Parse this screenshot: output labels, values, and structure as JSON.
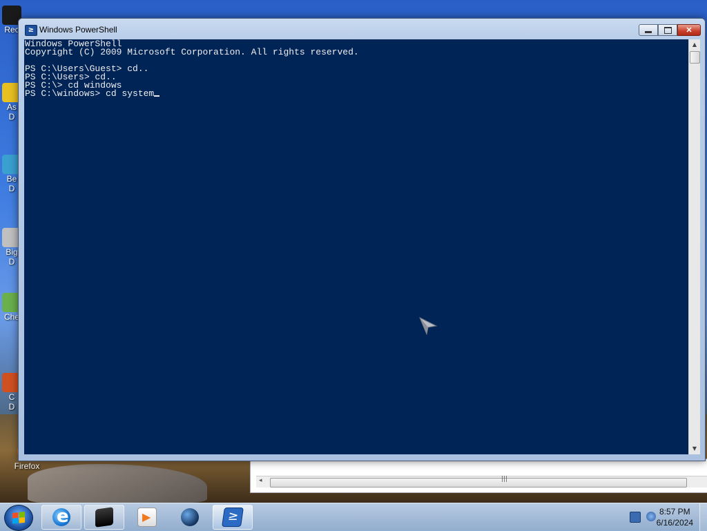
{
  "desktop": {
    "icons": [
      {
        "label": "Rec",
        "color": "#1a1a1a"
      },
      {
        "label": "As\nD",
        "color": "#e8c020"
      },
      {
        "label": "Be\nD",
        "color": "#3aa0d0"
      },
      {
        "label": "Big\nD",
        "color": "#c0c0c0"
      },
      {
        "label": "Che",
        "color": "#6ab04c"
      },
      {
        "label": "C\nD",
        "color": "#d05020"
      },
      {
        "label": "Firefox",
        "color": "#e86a1a"
      }
    ]
  },
  "window": {
    "title": "Windows PowerShell",
    "icon": "powershell-icon",
    "buttons": {
      "minimize": "minimize-icon",
      "maximize": "restore-icon",
      "close": "close-icon"
    },
    "close_glyph": "✕"
  },
  "console": {
    "lines": [
      "Windows PowerShell",
      "Copyright (C) 2009 Microsoft Corporation. All rights reserved.",
      "",
      "PS C:\\Users\\Guest> cd..",
      "PS C:\\Users> cd..",
      "PS C:\\> cd windows"
    ],
    "current_input": "PS C:\\windows> cd system",
    "background": "#012456",
    "foreground": "#eeedf0"
  },
  "scrollbar": {
    "up": "▲",
    "down": "▼"
  },
  "background_window": {
    "grip": "|||",
    "left": "◂"
  },
  "taskbar": {
    "start_icon": "windows-start-icon",
    "pinned": [
      {
        "name": "internet-explorer",
        "icon": "ie-icon"
      },
      {
        "name": "command-prompt",
        "icon": "cmd-icon"
      },
      {
        "name": "media-player",
        "icon": "media-player-icon"
      },
      {
        "name": "network-globe",
        "icon": "globe-icon"
      },
      {
        "name": "windows-powershell",
        "icon": "powershell-icon",
        "active": true
      }
    ],
    "tray": {
      "time": "8:57 PM",
      "date": "6/16/2024"
    }
  }
}
